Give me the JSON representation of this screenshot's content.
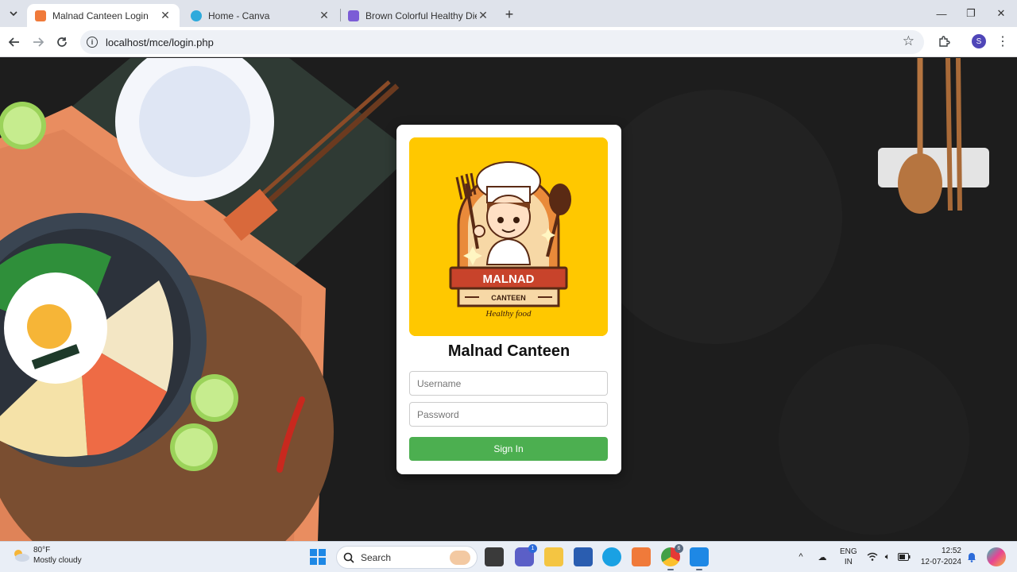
{
  "browser": {
    "tabs": [
      {
        "title": "Malnad Canteen Login",
        "active": true
      },
      {
        "title": "Home - Canva",
        "active": false
      },
      {
        "title": "Brown Colorful Healthy Diet Pre",
        "active": false
      }
    ],
    "url": "localhost/mce/login.php",
    "profile_initial": "S",
    "accent": "#4f46b8"
  },
  "login": {
    "logo": {
      "title": "MALNAD",
      "subtitle": "CANTEEN",
      "tagline": "Healthy food",
      "background": "#ffc800"
    },
    "heading": "Malnad Canteen",
    "username_placeholder": "Username",
    "password_placeholder": "Password",
    "submit_label": "Sign In",
    "submit_color": "#4caf50"
  },
  "taskbar": {
    "weather_temp": "80°F",
    "weather_desc": "Mostly cloudy",
    "search_label": "Search",
    "teams_badge": "1",
    "chrome_badge": "6",
    "lang_line1": "ENG",
    "lang_line2": "IN",
    "time": "12:52",
    "date": "12-07-2024"
  }
}
